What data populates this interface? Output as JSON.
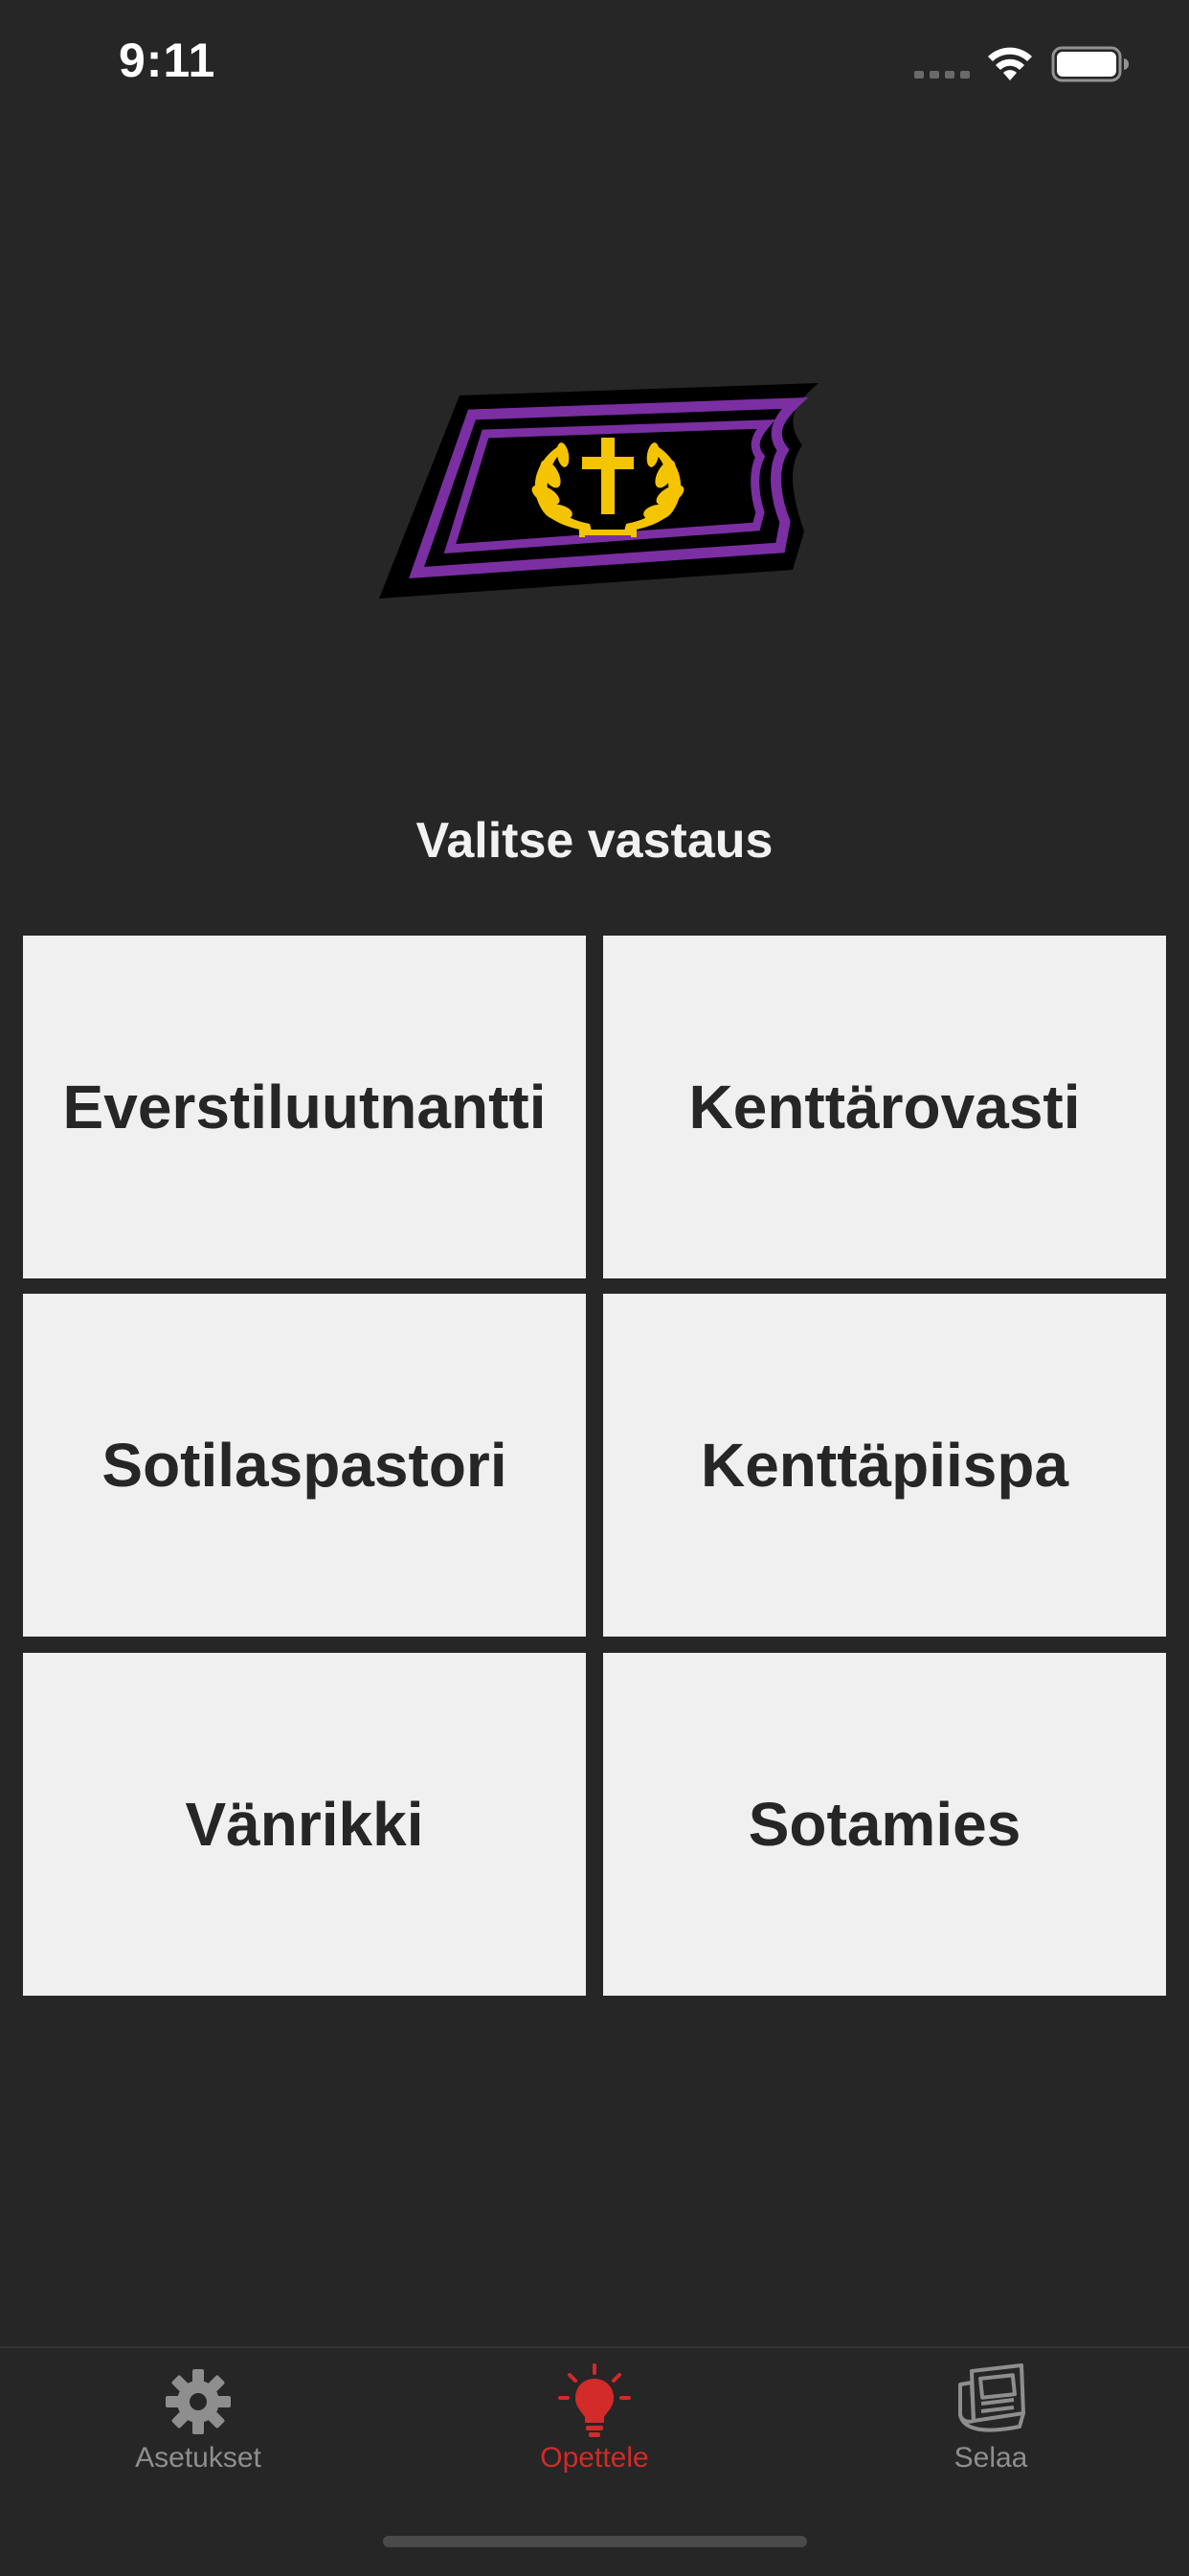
{
  "status_bar": {
    "time": "9:11"
  },
  "insignia": {
    "icon": "chaplain-collar-insignia-icon",
    "colors": {
      "base": "#000000",
      "stripe": "#7b2fa3",
      "emblem": "#f5c400"
    }
  },
  "prompt": "Valitse vastaus",
  "answers": [
    "Everstiluutnantti",
    "Kenttärovasti",
    "Sotilaspastori",
    "Kenttäpiispa",
    "Vänrikki",
    "Sotamies"
  ],
  "tabs": [
    {
      "label": "Asetukset",
      "icon": "gear-icon",
      "active": false
    },
    {
      "label": "Opettele",
      "icon": "lightbulb-icon",
      "active": true
    },
    {
      "label": "Selaa",
      "icon": "newspaper-icon",
      "active": false
    }
  ],
  "colors": {
    "background": "#262626",
    "answer_background": "#f0f0f0",
    "active_tab": "#d32a2a",
    "inactive_tab": "#8e8e8e"
  }
}
